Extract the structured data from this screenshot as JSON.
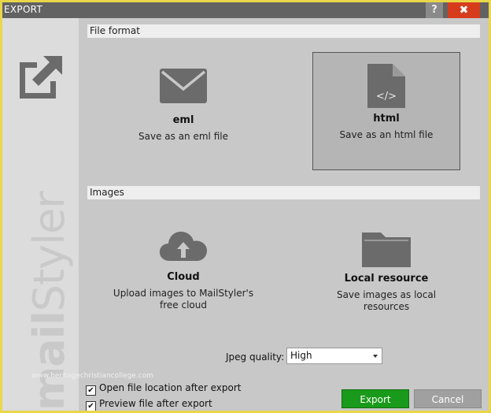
{
  "window": {
    "title": "EXPORT",
    "help_label": "?",
    "close_label": "✖"
  },
  "sidebar": {
    "brand_bold": "mail",
    "brand_light": "Styler",
    "icon": "export-arrow-icon"
  },
  "file_format": {
    "header": "File format",
    "options": [
      {
        "title": "eml",
        "desc": "Save as an eml file",
        "icon": "envelope-icon",
        "selected": false
      },
      {
        "title": "html",
        "desc": "Save as an html file",
        "icon": "html-file-icon",
        "selected": true
      }
    ]
  },
  "images": {
    "header": "Images",
    "options": [
      {
        "title": "Cloud",
        "desc_line1": "Upload images to MailStyler's",
        "desc_line2": "free cloud",
        "icon": "cloud-upload-icon"
      },
      {
        "title": "Local resource",
        "desc_line1": "Save images as local resources",
        "icon": "folder-icon"
      }
    ]
  },
  "jpeg": {
    "label": "Jpeg quality:",
    "value": "High"
  },
  "checkboxes": [
    {
      "label": "Open file location after export",
      "checked": true
    },
    {
      "label": "Preview file after export",
      "checked": true
    }
  ],
  "checkmark": "✔",
  "watermark": "www.heritagechristiancollege.com",
  "buttons": {
    "export": "Export",
    "cancel": "Cancel"
  },
  "colors": {
    "titlebar": "#626262",
    "close": "#d63c1c",
    "export_button": "#1a9a1a",
    "cancel_button": "#a0a0a0",
    "frame": "#e9d64a"
  }
}
